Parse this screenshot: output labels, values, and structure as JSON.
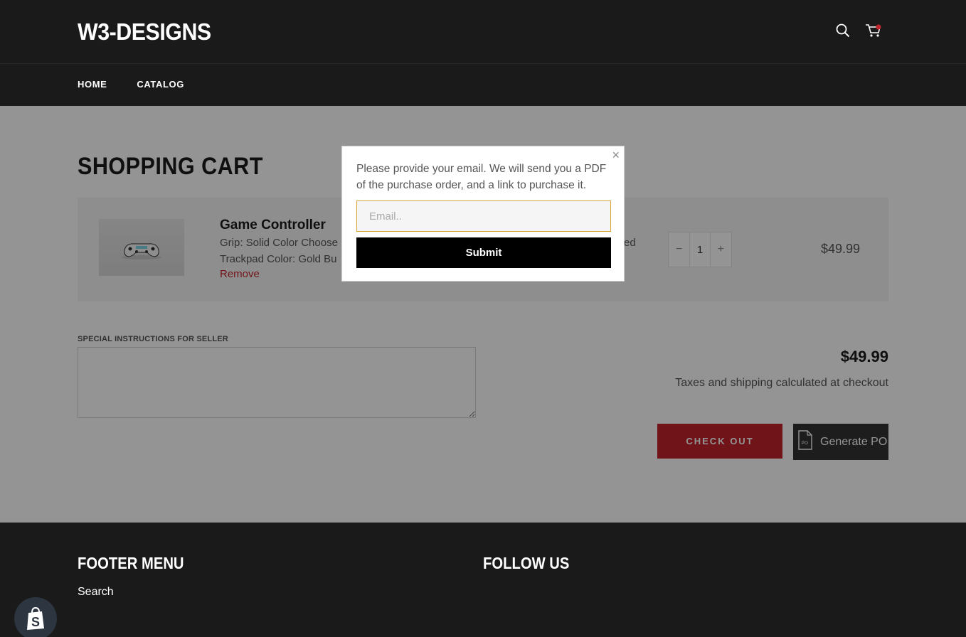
{
  "header": {
    "logo": "W3-DESIGNS",
    "nav": [
      "HOME",
      "CATALOG"
    ],
    "icons": [
      "search-icon",
      "cart-icon"
    ]
  },
  "cart": {
    "title": "SHOPPING CART",
    "item": {
      "name": "Game Controller",
      "variant_grip": "Grip: Solid Color Choose",
      "variant_trackpad": "Trackpad Color: Gold Bu",
      "variant_extra": "ed",
      "remove_label": "Remove",
      "quantity": "1",
      "qty_minus": "−",
      "qty_plus": "+",
      "price": "$49.99"
    },
    "notes_label": "SPECIAL INSTRUCTIONS FOR SELLER",
    "subtotal": "$49.99",
    "tax_note": "Taxes and shipping calculated at checkout",
    "checkout_label": "CHECK OUT",
    "po_label": "Generate PO",
    "po_icon_text": "PO"
  },
  "modal": {
    "close_label": "×",
    "message": "Please provide your email. We will send you a PDF of the purchase order, and a link to purchase it.",
    "email_placeholder": "Email..",
    "email_value": "",
    "submit_label": "Submit"
  },
  "footer": {
    "menu_title": "FOOTER MENU",
    "menu_link": "Search",
    "follow_title": "FOLLOW US"
  },
  "colors": {
    "accent": "#c2232e",
    "dark": "#1a1a1a",
    "input_focus": "#d8a531"
  }
}
